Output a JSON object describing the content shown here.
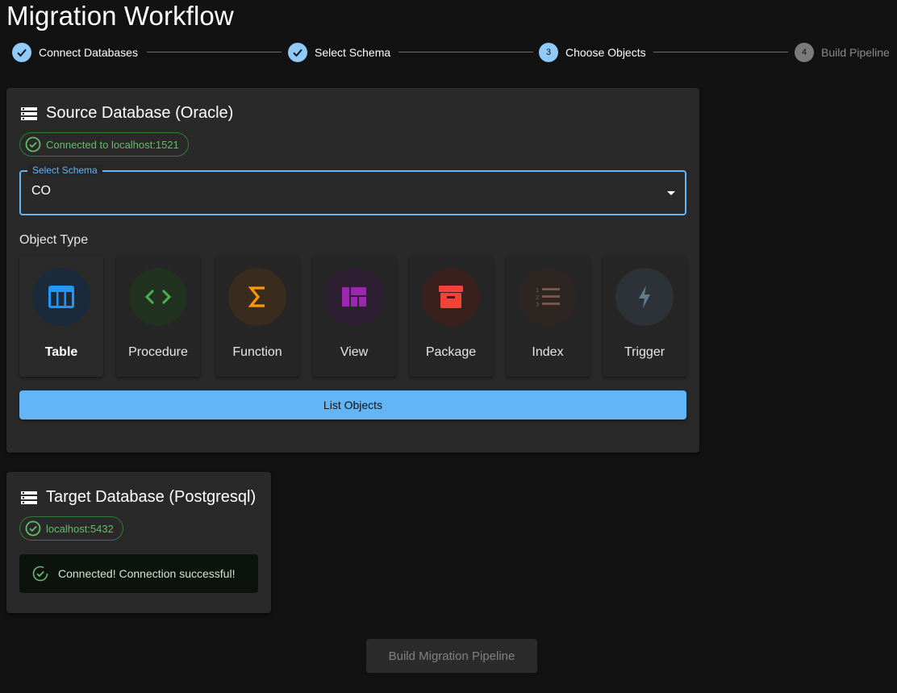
{
  "page": {
    "title": "Migration Workflow"
  },
  "stepper": {
    "steps": [
      {
        "label": "Connect Databases",
        "state": "completed",
        "number": "1"
      },
      {
        "label": "Select Schema",
        "state": "completed",
        "number": "2"
      },
      {
        "label": "Choose Objects",
        "state": "active",
        "number": "3"
      },
      {
        "label": "Build Pipeline",
        "state": "pending",
        "number": "4"
      }
    ]
  },
  "source": {
    "title": "Source Database (Oracle)",
    "icon": "database-icon",
    "status_chip": "Connected to localhost:1521",
    "schema_select": {
      "label": "Select Schema",
      "value": "CO"
    },
    "object_type_label": "Object Type",
    "object_types": [
      {
        "label": "Table",
        "icon": "table-icon",
        "color": "#2196f3",
        "selected": true
      },
      {
        "label": "Procedure",
        "icon": "code-icon",
        "color": "#4caf50",
        "selected": false
      },
      {
        "label": "Function",
        "icon": "sigma-icon",
        "color": "#ff9800",
        "selected": false
      },
      {
        "label": "View",
        "icon": "view-quilt-icon",
        "color": "#9c27b0",
        "selected": false
      },
      {
        "label": "Package",
        "icon": "archive-icon",
        "color": "#f44336",
        "selected": false
      },
      {
        "label": "Index",
        "icon": "list-numbered-icon",
        "color": "#795548",
        "selected": false
      },
      {
        "label": "Trigger",
        "icon": "bolt-icon",
        "color": "#607d8b",
        "selected": false
      }
    ],
    "list_button": "List Objects"
  },
  "target": {
    "title": "Target Database (Postgresql)",
    "icon": "database-icon",
    "status_chip": "localhost:5432",
    "alert": "Connected! Connection successful!"
  },
  "build_button": "Build Migration Pipeline",
  "colors": {
    "accent": "#90caf9",
    "success": "#66bb6a",
    "background": "#121212"
  }
}
